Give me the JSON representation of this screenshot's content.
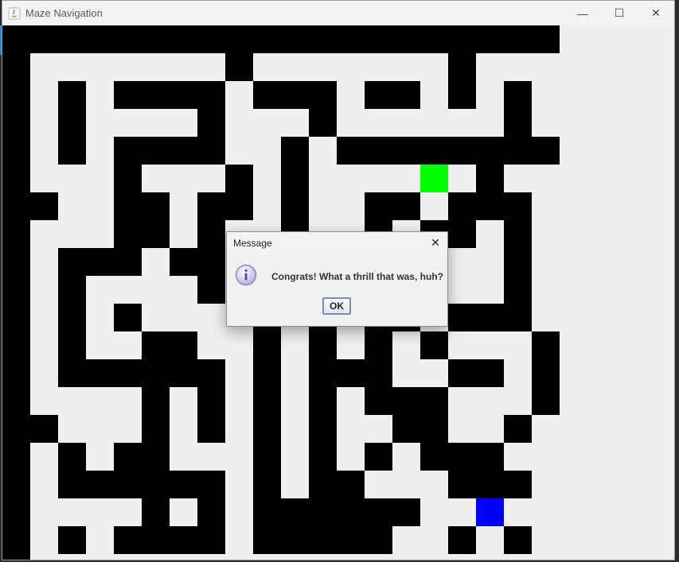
{
  "window": {
    "title": "Maze Navigation",
    "minimize_glyph": "—",
    "maximize_glyph": "☐",
    "close_glyph": "✕"
  },
  "maze": {
    "description_cols": 20,
    "wall_color": "#000000",
    "path_color": "#efefef",
    "start_color": "#00ff00",
    "goal_color": "#0000ff",
    "rows": [
      "11111111111111111111",
      "10000000100000001000",
      "10101111011101101010",
      "10100001000100000010",
      "10101111001011111111",
      "10001000101000000100",
      "11001101101001101110",
      "10001101001001011010",
      "10111011011011100010",
      "10100001000001100010",
      "10101000010101101110",
      "10100110010101010001",
      "10111111010111001101",
      "10000101010101110001",
      "11000101010100110010",
      "10101100010101011100",
      "10111111010110001110",
      "10000101011111100100",
      "10101111011111001010",
      "10000000000000000000"
    ],
    "start_cell": "row 5, col 15",
    "goal_cell": "row 17, col 17"
  },
  "dialog": {
    "title": "Message",
    "close_glyph": "✕",
    "icon": "info-icon",
    "message": "Congrats! What a thrill that was, huh?",
    "ok_label": "OK"
  }
}
